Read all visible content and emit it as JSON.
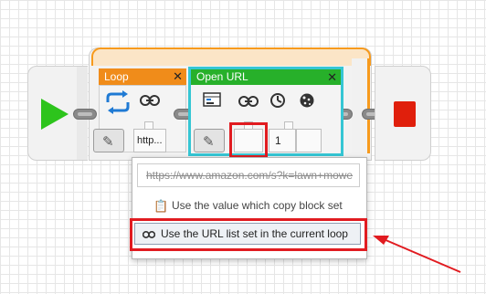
{
  "loop": {
    "label": "Loop",
    "url_value": "http...",
    "close_glyph": "✕"
  },
  "open_url": {
    "label": "Open URL",
    "close_glyph": "✕",
    "number_value": "1"
  },
  "dropdown": {
    "url_text": "https://www.amazon.com/s?k=lawn+mowe",
    "option_copy_label": "Use the value which copy block set",
    "option_loop_label": "Use the URL list set in the current loop"
  },
  "icons": [
    "play-icon",
    "loop-icon",
    "link-icon",
    "pencil-icon",
    "table-icon",
    "timer-icon",
    "cookie-icon",
    "stop-icon",
    "clipboard-icon"
  ],
  "colors": {
    "accent_loop": "#f08c1a",
    "accent_open_url": "#27b02a",
    "selection": "#35c6d4",
    "highlight": "#e11b20",
    "play": "#2dc41c",
    "stop": "#e01f0c"
  }
}
